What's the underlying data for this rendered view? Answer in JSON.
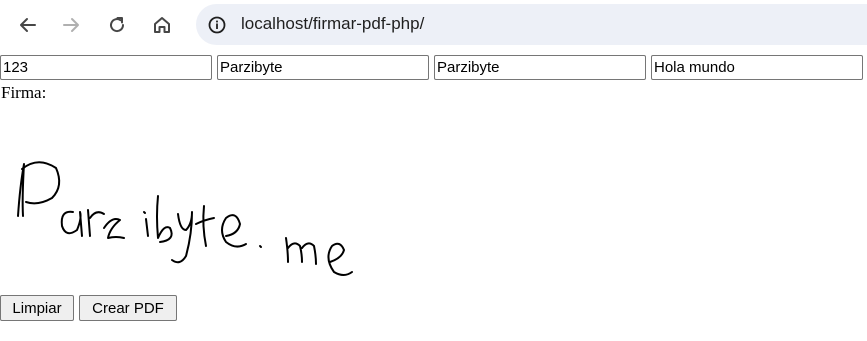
{
  "browser": {
    "url": "localhost/firmar-pdf-php/"
  },
  "form": {
    "fields": [
      {
        "value": "123"
      },
      {
        "value": "Parzibyte"
      },
      {
        "value": "Parzibyte"
      },
      {
        "value": "Hola mundo"
      }
    ],
    "signature_label": "Firma:",
    "clear_button": "Limpiar",
    "create_pdf_button": "Crear PDF"
  },
  "icons": {
    "back": "arrow-left-icon",
    "forward": "arrow-right-icon",
    "reload": "reload-icon",
    "home": "home-icon",
    "site_info": "info-circle-icon"
  },
  "colors": {
    "omnibox_bg": "#edf0f7",
    "icon_active": "#474747",
    "icon_disabled": "#b0b0b0"
  }
}
